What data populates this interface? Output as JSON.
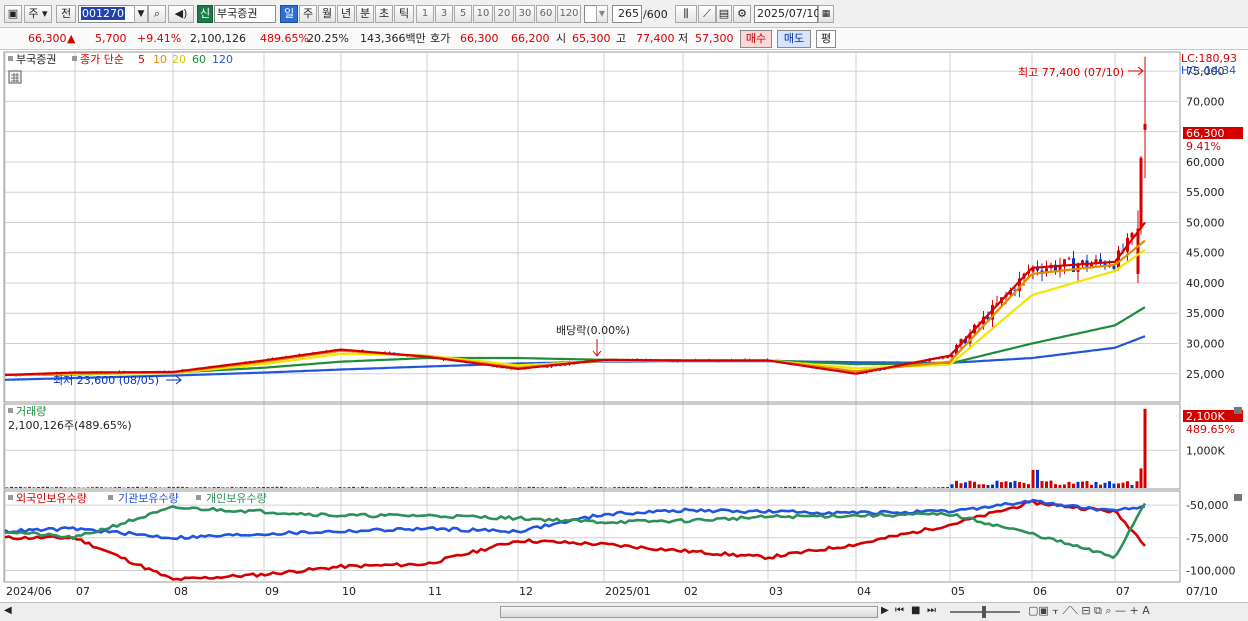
{
  "toolbar": {
    "market": "주",
    "prev": "전",
    "code": "001270",
    "new_badge": "신",
    "name": "부국증권",
    "periods": [
      "일",
      "주",
      "월",
      "년",
      "분",
      "초",
      "틱"
    ],
    "active_period": "일",
    "intervals": [
      "1",
      "3",
      "5",
      "10",
      "20",
      "30",
      "60",
      "120"
    ],
    "count": "265",
    "count_total": "/600",
    "date": "2025/07/10"
  },
  "quote": {
    "price": "66,300",
    "arrow": "▲",
    "change": "5,700",
    "change_pct": "+9.41%",
    "volume": "2,100,126",
    "volume_ratio": "489.65%",
    "turnover": "20.25%",
    "amount": "143,366백만",
    "hoga_label": "호가",
    "ask": "66,300",
    "bid": "66,200",
    "open_label": "시",
    "open": "65,300",
    "high_label": "고",
    "high": "77,400",
    "low_label": "저",
    "low": "57,300",
    "buy": "매수",
    "sell": "매도",
    "avg": "평"
  },
  "colors": {
    "up": "#d40000",
    "down": "#0033cc",
    "ma5": "#d40000",
    "ma10": "#e68a00",
    "ma20": "#f2e600",
    "ma60": "#1e8c3a",
    "ma120": "#2255dd",
    "foreign": "#d40000",
    "institution": "#2255dd",
    "individual": "#2f8f5a"
  },
  "price_panel": {
    "stock_label": "부국증권",
    "ma_prefix": "종가 단순",
    "ma_periods": [
      "5",
      "10",
      "20",
      "60",
      "120"
    ],
    "lc": "LC:180,93",
    "hc": "HC:-14,34",
    "current_price": "66,300",
    "current_pct": "9.41%",
    "max_label": "최고 77,400 (07/10)",
    "min_label": "최저 23,600 (08/05)",
    "dividend_label": "배당락(0.00%)",
    "y_ticks": [
      "75,000",
      "70,000",
      "65,000",
      "60,000",
      "55,000",
      "50,000",
      "45,000",
      "40,000",
      "35,000",
      "30,000",
      "25,000"
    ]
  },
  "volume_panel": {
    "title": "거래량",
    "value": "2,100,126주(489.65%)",
    "current": "2,100K",
    "current_pct": "489.65%",
    "y_ticks": [
      "1,000K"
    ]
  },
  "holding_panel": {
    "legend": [
      "외국인보유수량",
      "기관보유수량",
      "개인보유수량"
    ],
    "y_ticks": [
      "-50,000",
      "-75,000",
      "-100,000"
    ]
  },
  "x_axis": {
    "labels": [
      "2024/06",
      "07",
      "08",
      "09",
      "10",
      "11",
      "12",
      "2025/01",
      "02",
      "03",
      "04",
      "05",
      "06",
      "07"
    ],
    "current": "07/10"
  },
  "chart_data": {
    "type": "line",
    "title": "",
    "y_ticks": [
      25000,
      30000,
      35000,
      40000,
      45000,
      50000,
      55000,
      60000,
      65000,
      70000,
      75000
    ],
    "ylim": [
      20500,
      78000
    ],
    "x": [
      "2024/06",
      "07",
      "08",
      "09",
      "10",
      "11",
      "12",
      "2025/01",
      "02",
      "03",
      "04",
      "05",
      "06",
      "07",
      "07/10"
    ],
    "series": [
      {
        "name": "5",
        "values": [
          24800,
          25200,
          25300,
          27200,
          29000,
          27800,
          25800,
          27300,
          27200,
          27200,
          25000,
          28000,
          42500,
          43500,
          50000
        ]
      },
      {
        "name": "10",
        "values": [
          24800,
          25100,
          25200,
          27000,
          28800,
          27900,
          26000,
          27200,
          27200,
          27200,
          25400,
          27000,
          41500,
          43000,
          47000
        ]
      },
      {
        "name": "20",
        "values": [
          24800,
          25000,
          25100,
          26600,
          28300,
          28000,
          26400,
          27100,
          27200,
          27200,
          25900,
          26500,
          38000,
          42000,
          45500
        ]
      },
      {
        "name": "60",
        "values": [
          24800,
          24900,
          25200,
          26000,
          27000,
          27600,
          27600,
          27300,
          27200,
          27200,
          26600,
          26700,
          30000,
          33000,
          36000
        ]
      },
      {
        "name": "120",
        "values": [
          24000,
          24300,
          24700,
          25200,
          25700,
          26200,
          26700,
          27000,
          27100,
          27100,
          26900,
          26800,
          27600,
          29300,
          31200
        ]
      }
    ],
    "max": {
      "date": "07/10",
      "value": 77400
    },
    "min": {
      "date": "08/05",
      "value": 23600
    },
    "last": 66300,
    "volume": {
      "ylim": [
        0,
        2200000
      ],
      "y_ticks": [
        1000000
      ],
      "last": 2100126
    },
    "holdings": {
      "ylim": [
        -108000,
        -40000
      ],
      "y_ticks": [
        -50000,
        -75000,
        -100000
      ],
      "series": [
        {
          "name": "외국인보유수량",
          "values": [
            -75000,
            -75000,
            -107000,
            -103000,
            -97000,
            -95000,
            -77000,
            -80000,
            -85000,
            -90000,
            -80000,
            -65000,
            -48000,
            -55000,
            -80000
          ]
        },
        {
          "name": "기관보유수량",
          "values": [
            -70000,
            -68000,
            -75000,
            -72000,
            -70000,
            -68000,
            -70000,
            -57000,
            -54000,
            -55000,
            -56000,
            -55000,
            -47000,
            -55000,
            -50000
          ]
        },
        {
          "name": "개인보유수량",
          "values": [
            -70000,
            -75000,
            -52000,
            -55000,
            -58000,
            -58000,
            -60000,
            -63000,
            -62000,
            -59000,
            -58000,
            -57000,
            -72000,
            -90000,
            -48000
          ]
        }
      ]
    }
  }
}
